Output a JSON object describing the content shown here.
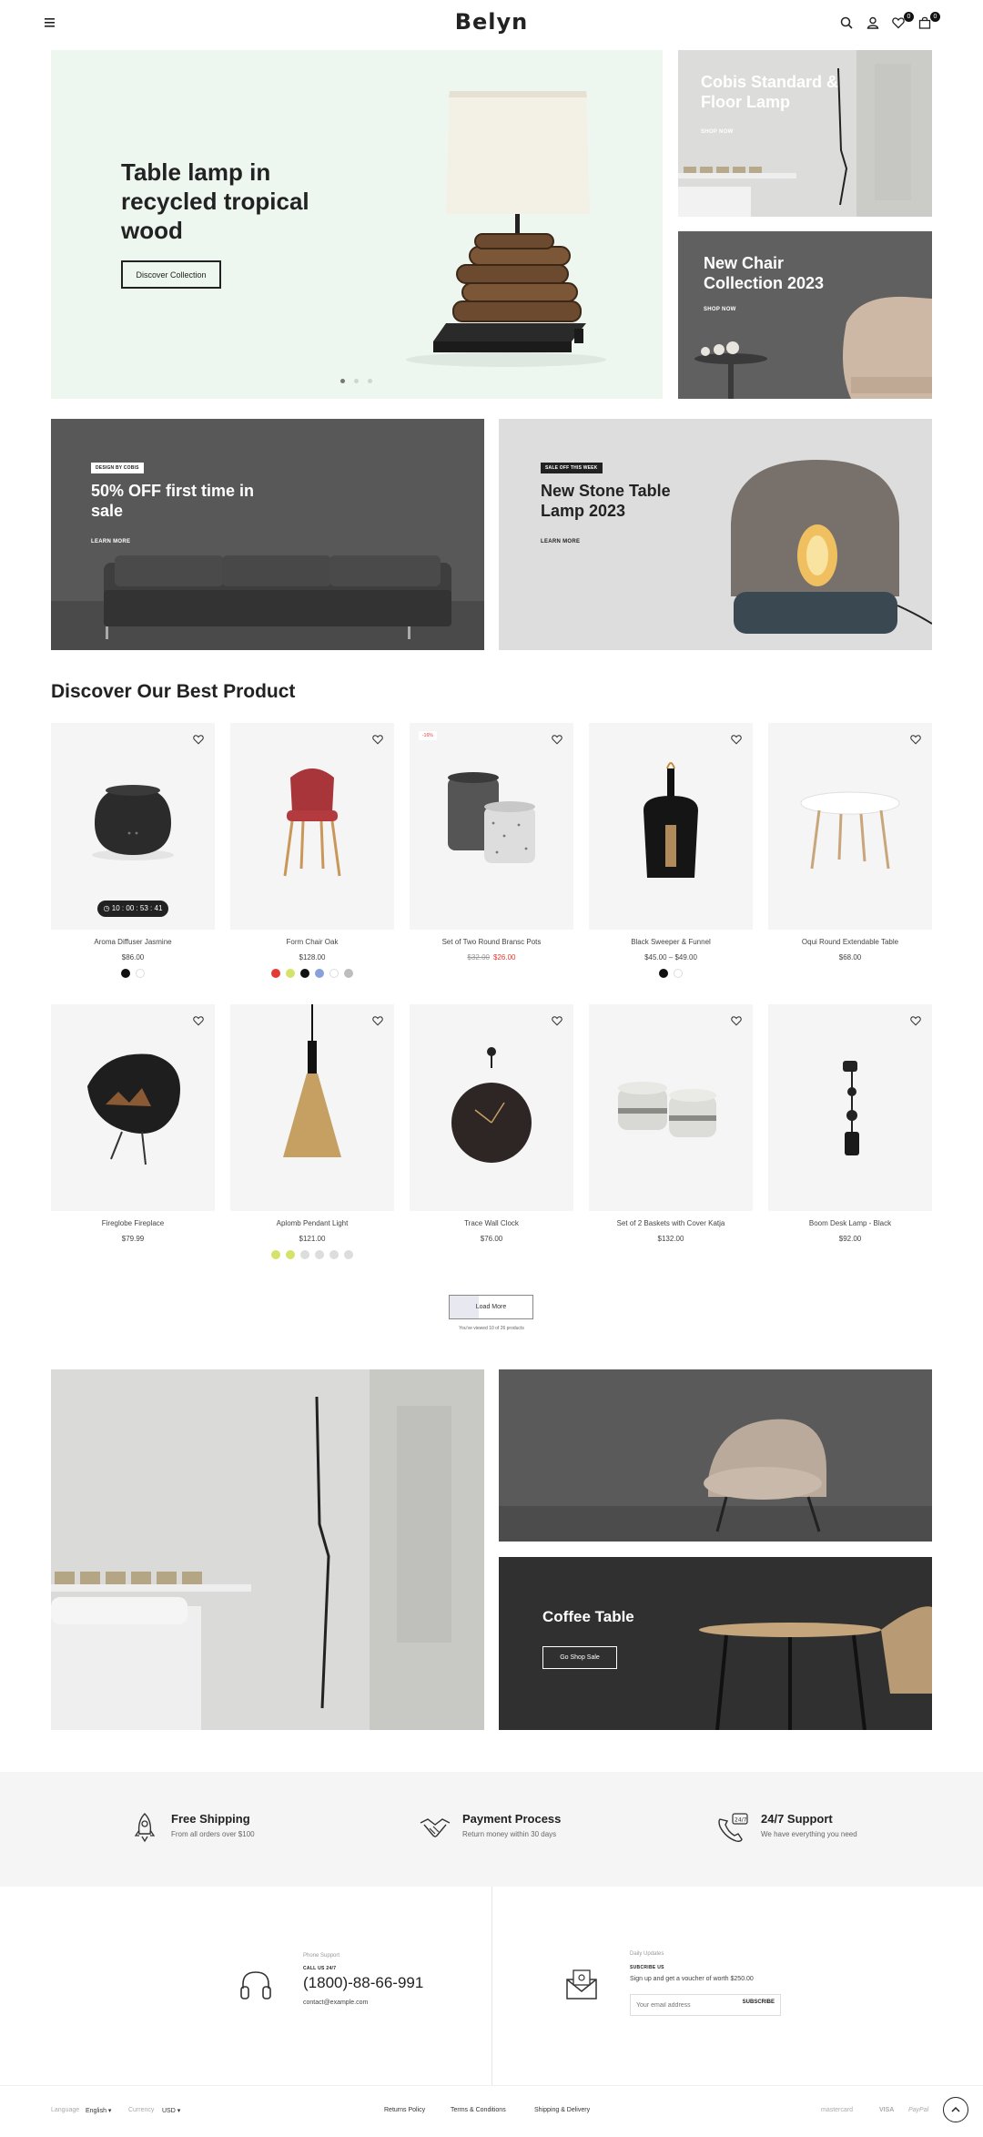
{
  "header": {
    "logo": "Belyn",
    "cart_count": "0",
    "wishlist_count": "0"
  },
  "hero": {
    "title": "Table lamp in recycled tropical wood",
    "button": "Discover Collection",
    "slides": 3,
    "active_slide": 1
  },
  "side_banners": [
    {
      "title": "Cobis Standard & Floor Lamp",
      "link": "SHOP NOW"
    },
    {
      "title": "New Chair Collection 2023",
      "link": "SHOP NOW"
    }
  ],
  "promos": [
    {
      "tag": "DESIGN BY COBIS",
      "title": "50% OFF first time in sale",
      "link": "LEARN MORE"
    },
    {
      "tag": "SALE OFF THIS WEEK",
      "title": "New Stone Table Lamp 2023",
      "link": "LEARN MORE"
    }
  ],
  "products": {
    "section_title": "Discover Our Best Product",
    "items": [
      {
        "name": "Aroma Diffuser Jasmine",
        "price": "$86.00",
        "timer": "10 : 00 : 53 : 41",
        "swatches": [
          "#111111",
          "#ffffff"
        ]
      },
      {
        "name": "Form Chair Oak",
        "price": "$128.00",
        "swatches": [
          "#e53935",
          "#d6e36a",
          "#111111",
          "#8aa0d8",
          "#ffffff",
          "#bdbdbd"
        ]
      },
      {
        "name": "Set of Two Round Bransc Pots",
        "old_price": "$32.00",
        "price": "$26.00",
        "badge": "-16%"
      },
      {
        "name": "Black Sweeper & Funnel",
        "price": "$45.00 – $49.00",
        "swatches": [
          "#111111",
          "#ffffff"
        ]
      },
      {
        "name": "Oqui Round Extendable Table",
        "price": "$68.00"
      },
      {
        "name": "Fireglobe Fireplace",
        "price": "$79.99"
      },
      {
        "name": "Aplomb Pendant Light",
        "price": "$121.00",
        "swatches": [
          "#d6e36a",
          "#d6e36a",
          "#dddddd",
          "#dddddd",
          "#dddddd",
          "#dddddd"
        ]
      },
      {
        "name": "Trace Wall Clock",
        "price": "$76.00"
      },
      {
        "name": "Set of 2 Baskets with Cover Katja",
        "price": "$132.00"
      },
      {
        "name": "Boom Desk Lamp - Black",
        "price": "$92.00"
      }
    ],
    "load_more": "Load More",
    "viewed_text": "You've viewed 10 of 26 products"
  },
  "lookbook": {
    "title": "Coffee Table",
    "button": "Go Shop Sale"
  },
  "features": [
    {
      "title": "Free Shipping",
      "subtitle": "From all orders over $100",
      "icon": "rocket-icon"
    },
    {
      "title": "Payment Process",
      "subtitle": "Return money within 30 days",
      "icon": "handshake-icon"
    },
    {
      "title": "24/7 Support",
      "subtitle": "We have everything you need",
      "icon": "phone-support-icon"
    }
  ],
  "contact": {
    "phone_label": "Phone Support",
    "call_label": "CALL US 24/7",
    "phone": "(1800)-88-66-991",
    "email": "contact@example.com",
    "updates_label": "Daily Updates",
    "subscribe_label": "SUBCRIBE US",
    "subscribe_text": "Sign up and get a voucher of worth $250.00",
    "email_placeholder": "Your email address",
    "subscribe_button": "SUBSCRIBE"
  },
  "footer": {
    "language_label": "Language",
    "language": "English",
    "currency_label": "Currency",
    "currency": "USD",
    "links": [
      "Returns Policy",
      "Terms & Conditions",
      "Shipping & Delivery"
    ],
    "payments": [
      "mastercard",
      "VISA",
      "PayPal"
    ]
  },
  "colors": {
    "hero_bg": "#eef6f0",
    "sale": "#e53935",
    "dark": "#222222"
  }
}
